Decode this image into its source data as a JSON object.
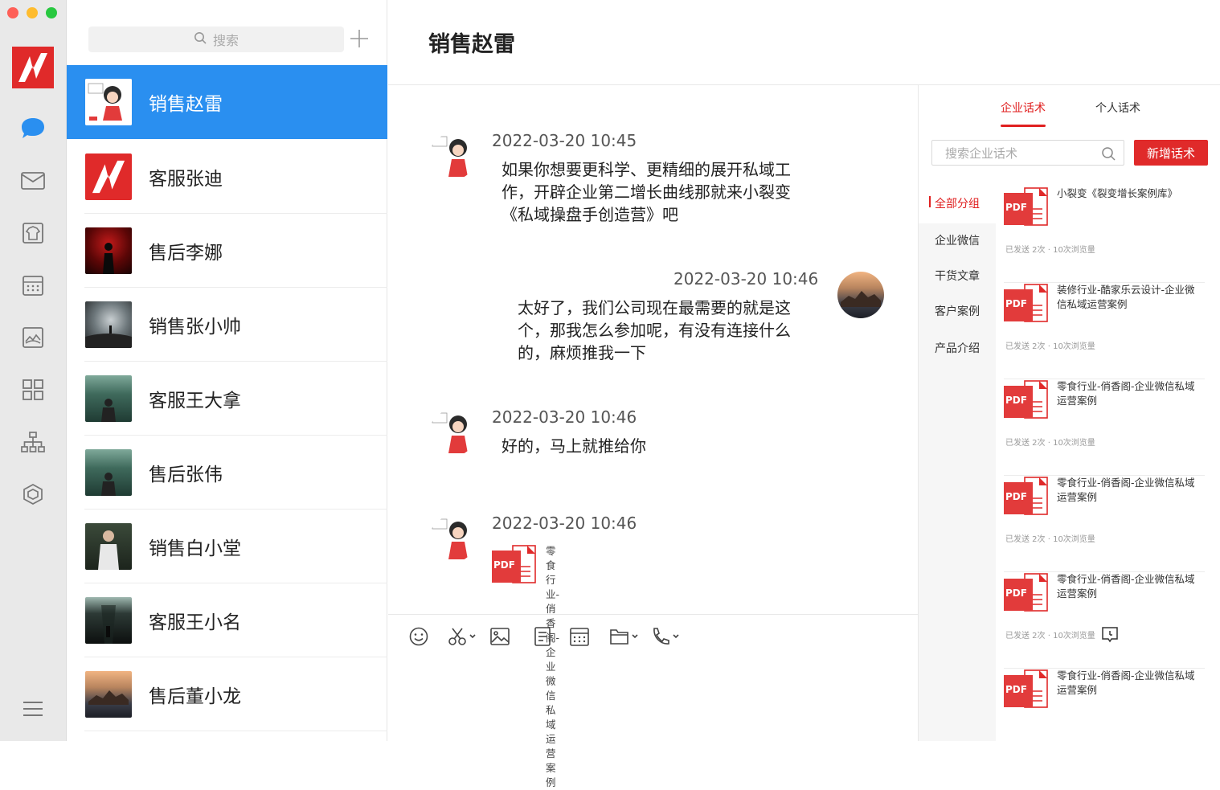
{
  "window": {
    "controls": [
      "close",
      "minimize",
      "zoom"
    ]
  },
  "nav": {
    "items": [
      {
        "name": "chat",
        "icon": "chat-bubble-icon",
        "active": true
      },
      {
        "name": "mail",
        "icon": "mail-icon"
      },
      {
        "name": "templates",
        "icon": "shirt-icon"
      },
      {
        "name": "calendar",
        "icon": "calendar-icon"
      },
      {
        "name": "gallery",
        "icon": "image-icon"
      },
      {
        "name": "apps",
        "icon": "grid-icon"
      },
      {
        "name": "org",
        "icon": "org-chart-icon"
      },
      {
        "name": "cube",
        "icon": "cube-icon"
      },
      {
        "name": "menu",
        "icon": "hamburger-menu-icon"
      }
    ],
    "accent": "#2a8ff0"
  },
  "contacts": {
    "search_placeholder": "搜索",
    "items": [
      {
        "name": "销售赵雷",
        "active": true
      },
      {
        "name": "客服张迪"
      },
      {
        "name": "售后李娜"
      },
      {
        "name": "销售张小帅"
      },
      {
        "name": "客服王大拿"
      },
      {
        "name": "售后张伟"
      },
      {
        "name": "销售白小堂"
      },
      {
        "name": "客服王小名"
      },
      {
        "name": "售后董小龙"
      }
    ]
  },
  "chat": {
    "title": "销售赵雷",
    "messages": [
      {
        "side": "left",
        "time": "2022-03-20  10:45",
        "text": [
          "如果你想要更科学、更精细的展开私域工",
          "作，开辟企业第二增长曲线那就来小裂变",
          "《私域操盘手创造营》吧"
        ]
      },
      {
        "side": "right",
        "time": "2022-03-20  10:46",
        "text": [
          "太好了，我们公司现在最需要的就是这",
          "个，那我怎么参加呢，有没有连接什么",
          "的，麻烦推我一下"
        ]
      },
      {
        "side": "left",
        "time": "2022-03-20  10:46",
        "text": [
          "好的，马上就推给你"
        ]
      },
      {
        "side": "left",
        "time": "2022-03-20  10:46",
        "file": [
          "零食行业-俏香阁-企业微信",
          "私域运营案例"
        ]
      }
    ]
  },
  "toolbar": [
    "emoji-icon",
    "scissors-icon",
    "image-icon",
    "document-icon",
    "calendar-icon",
    "folder-icon",
    "phone-icon"
  ],
  "scripts": {
    "tabs": [
      "企业话术",
      "个人话术"
    ],
    "search_placeholder": "搜索企业话术",
    "add_button": "新增话术",
    "categories": [
      "全部分组",
      "企业微信",
      "干货文章",
      "客户案例",
      "产品介绍"
    ],
    "pdf_label": "PDF",
    "cards": [
      {
        "title": "小裂变《裂变增长案例库》",
        "meta": "已发送 2次 · 10次浏览量"
      },
      {
        "title": "装修行业-酷家乐云设计-企业微信私域运营案例",
        "meta": "已发送 2次 · 10次浏览量"
      },
      {
        "title": "零食行业-俏香阁-企业微信私域运营案例",
        "meta": "已发送 2次 · 10次浏览量"
      },
      {
        "title": "零食行业-俏香阁-企业微信私域运营案例",
        "meta": "已发送 2次 · 10次浏览量"
      },
      {
        "title": "零食行业-俏香阁-企业微信私域运营案例",
        "meta": "已发送 2次 · 10次浏览量"
      },
      {
        "title": "零食行业-俏香阁-企业微信私域运营案例",
        "meta": "已发送 2次 · 10次浏览量"
      }
    ],
    "accent": "#e02020"
  }
}
